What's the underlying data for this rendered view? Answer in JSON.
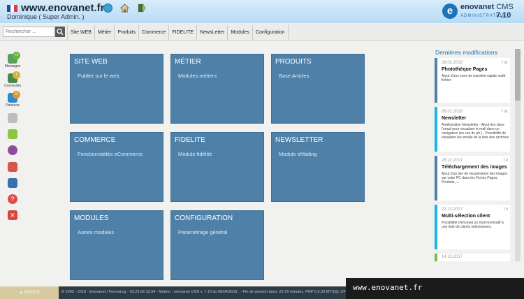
{
  "header": {
    "site_title": "www.enovanet.fr",
    "user": "Dominique ( Super Admin. )",
    "icons": [
      "flag-fr-icon",
      "globe-icon",
      "home-icon",
      "logout-icon"
    ],
    "logo": {
      "letter": "e",
      "name": "enovanet",
      "name_suffix": "CMS",
      "subtitle": "ADMINISTRATION",
      "version": "7.10"
    }
  },
  "toolbar": {
    "search_placeholder": "Rechercher ...",
    "nav": [
      "Site WEB",
      "Métier",
      "Produits",
      "Commerce",
      "FIDELITE",
      "NewsLetter",
      "Modules",
      "Configuration"
    ]
  },
  "sidebar": [
    {
      "icon": "messages-icon",
      "label": "Messages",
      "badge": "+1",
      "color": "#5aa15a",
      "badge_color": "#6ab24a"
    },
    {
      "icon": "connected-icon",
      "label": "Connectés",
      "badge": "1",
      "color": "#4a8a4a",
      "badge_color": "#d6b13a"
    },
    {
      "icon": "baskets-icon",
      "label": "Paniours",
      "badge": "0",
      "color": "#2f8bd0",
      "badge_color": "#e8962c"
    },
    {
      "icon": "cube-icon",
      "label": "",
      "color": "#bdbdbd"
    },
    {
      "icon": "box-icon",
      "label": "",
      "color": "#8dc63f"
    },
    {
      "icon": "gauge-icon",
      "label": "",
      "color": "#8c4da0"
    },
    {
      "icon": "chart-icon",
      "label": "",
      "color": "#d9534f"
    },
    {
      "icon": "book-icon",
      "label": "",
      "color": "#3a6fb0"
    },
    {
      "icon": "help-icon",
      "label": "",
      "color": "#e04c4c"
    },
    {
      "icon": "close-icon",
      "label": "",
      "color": "#d9443f"
    }
  ],
  "tiles": [
    {
      "title": "SITE WEB",
      "subtitle": "Publier sur le web."
    },
    {
      "title": "MÉTIER",
      "subtitle": "Modules métiers"
    },
    {
      "title": "PRODUITS",
      "subtitle": "Base Articles"
    },
    {
      "title": "COMMERCE",
      "subtitle": "Fonctionnalités eCommerce"
    },
    {
      "title": "FIDELITE",
      "subtitle": "Module fidélité"
    },
    {
      "title": "NEWSLETTER",
      "subtitle": "Module eMailing"
    },
    {
      "title": "MODULES",
      "subtitle": "Autres modules"
    },
    {
      "title": "CONFIGURATION",
      "subtitle": "Paramétrage général"
    }
  ],
  "right_panel": {
    "title": "Dernières modifications",
    "cards": [
      {
        "date": "28.02.2018",
        "time": "7.9c",
        "title": "Photothèque Pages",
        "desc": "Ajout d'une zone de transfert rapide multi-fichier.",
        "accent": "#4f81a8"
      },
      {
        "date": "06.01.2018",
        "time": "7.9c",
        "title": "Newsletter",
        "desc": "Amélioration Newsletter - Ajout lien dans l'email pour visualiser le mail dans un navigateur (en cas de pb.) - Possibilité de visualiser les emails de la liste des archives",
        "accent": "#19b5e6"
      },
      {
        "date": "26.12.2017",
        "time": "7.9",
        "title": "Téléchargement des images",
        "desc": "Ajout d'un lien de récupération des images sur votre PC dans les Fiches Pages, Produits, ...",
        "accent": "#4f81a8"
      },
      {
        "date": "22.12.2017",
        "time": "7.9",
        "title": "Multi-sélection client",
        "desc": "Possibilité d'envoyer un mail nominatif à une liste de clients sélectionnés.",
        "accent": "#19b5e6"
      },
      {
        "date": "14.12.2017",
        "time": "",
        "title": "",
        "desc": "",
        "accent": "#6cc04a"
      }
    ]
  },
  "footer": {
    "tools": "▲ OUTILS",
    "text": "© 2003 - 2018 · Enovanet / FormaLog - 03.23.82.32.64 - Moteur : enovanet CMS v. 7.10 du 08/04/2018 . - Fin de session dans: 23.78 minutes.   PHP 5.6.33   MYSQL OFF   SSL OFF   enovanetDOC : 14.70 Mo",
    "badge": "www.enovanet.fr"
  }
}
